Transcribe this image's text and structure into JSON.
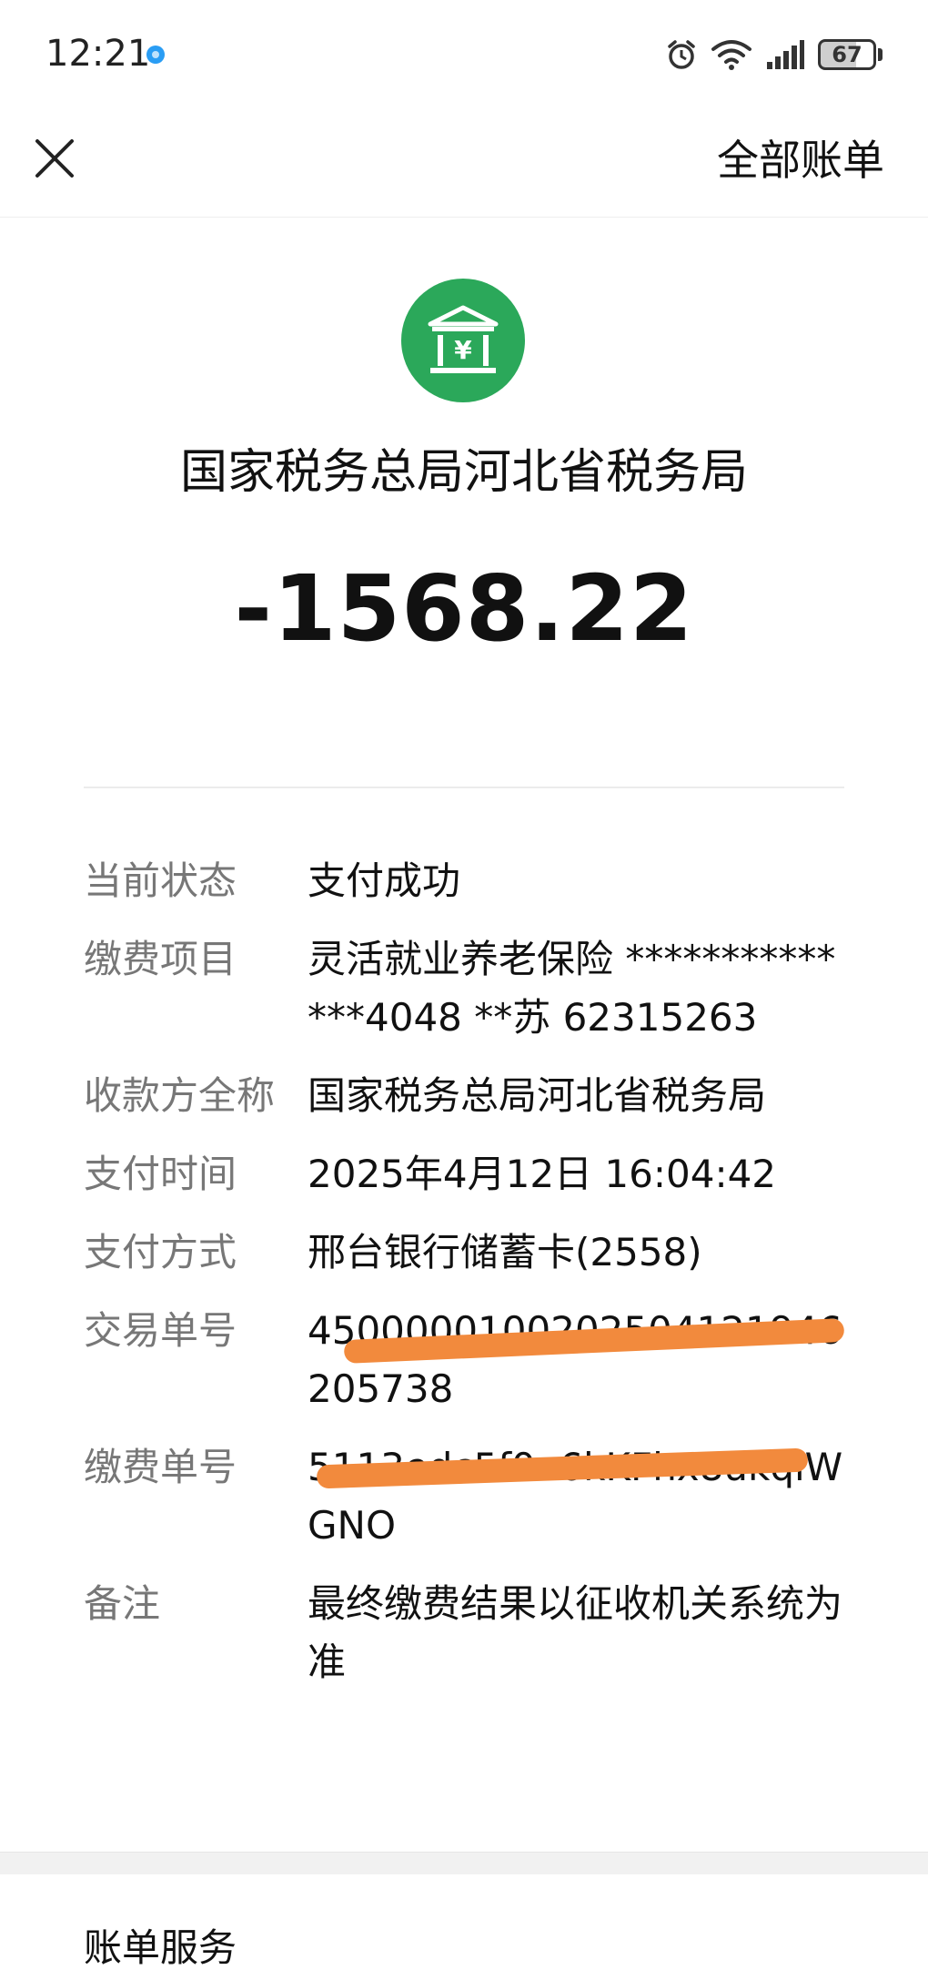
{
  "status_bar": {
    "time": "12:21",
    "battery": "67"
  },
  "nav": {
    "all_bills_label": "全部账单"
  },
  "header": {
    "merchant_name": "国家税务总局河北省税务局",
    "amount": "-1568.22"
  },
  "details": [
    {
      "label": "当前状态",
      "value": "支付成功"
    },
    {
      "label": "缴费项目",
      "value": "灵活就业养老保险 **************4048 **苏 62315263"
    },
    {
      "label": "收款方全称",
      "value": "国家税务总局河北省税务局"
    },
    {
      "label": "支付时间",
      "value": "2025年4月12日 16:04:42"
    },
    {
      "label": "支付方式",
      "value": "邢台银行储蓄卡(2558)"
    },
    {
      "label": "交易单号",
      "value": "4500000100202504121946205738"
    },
    {
      "label": "缴费单号",
      "value": "5113edc5f0a6kKFhx8ukqiWGNO"
    },
    {
      "label": "备注",
      "value": "最终缴费结果以征收机关系统为准"
    }
  ],
  "services": {
    "title": "账单服务"
  },
  "colors": {
    "accent_green": "#2ba85a",
    "redaction": "#f28a3d",
    "label_gray": "#777777"
  },
  "icons": {
    "close": "close-icon",
    "merchant": "bank-yuan-icon",
    "alarm": "alarm-icon",
    "wifi": "wifi-icon",
    "signal": "signal-icon",
    "battery": "battery-icon",
    "notification": "app-notification-icon"
  }
}
